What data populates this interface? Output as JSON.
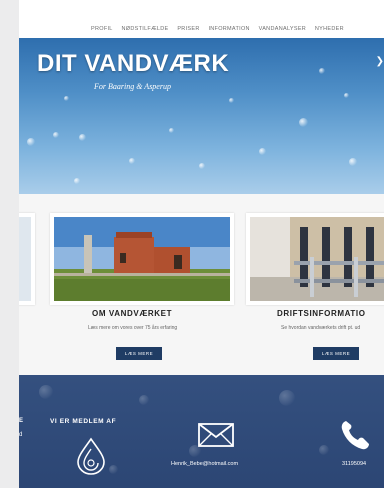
{
  "nav": {
    "items": [
      "PROFIL",
      "NØDSTILFÆLDE",
      "PRISER",
      "INFORMATION",
      "VANDANALYSER",
      "NYHEDER"
    ]
  },
  "hero": {
    "title": "DIT VANDVÆRK",
    "subtitle": "For Baaring & Asperup"
  },
  "cards": [
    {
      "title": "OM VANDVÆRKET",
      "text": "Læs mere om vores over 75 års erfaring",
      "button": "LÆS MERE"
    },
    {
      "title": "DRIFTSINFORMATIO",
      "text": "Se hvordan vandværkets drift pt. ud",
      "button": "LÆS MERE"
    }
  ],
  "footer": {
    "member_heading": "VI ER MEDLEM AF",
    "left_fragment_1": "E",
    "left_fragment_2": "d",
    "email": "Henrik_Bebe@hotmail.com",
    "phone": "31195094"
  },
  "icons": {
    "email": "envelope-icon",
    "phone": "phone-icon",
    "logo": "water-drop-logo-icon"
  },
  "colors": {
    "footer_bg": "#2f4a78",
    "button_bg": "#1f3c64",
    "hero_top": "#2e6eae"
  }
}
